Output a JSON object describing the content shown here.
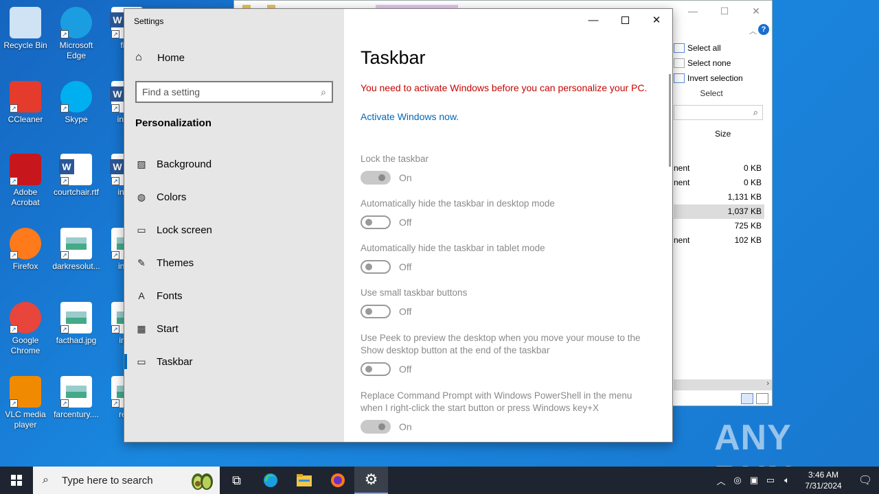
{
  "desktop": {
    "icons_col1": [
      {
        "label": "Recycle Bin",
        "icon": "recycle-bin-icon"
      },
      {
        "label": "CCleaner",
        "icon": "ccleaner-icon"
      },
      {
        "label": "Adobe Acrobat",
        "icon": "acrobat-icon"
      },
      {
        "label": "Firefox",
        "icon": "firefox-icon"
      },
      {
        "label": "Google Chrome",
        "icon": "chrome-icon"
      },
      {
        "label": "VLC media player",
        "icon": "vlc-icon"
      }
    ],
    "icons_col2": [
      {
        "label": "Microsoft Edge",
        "icon": "edge-icon"
      },
      {
        "label": "Skype",
        "icon": "skype-icon"
      },
      {
        "label": "courtchair.rtf",
        "icon": "word-doc-icon"
      },
      {
        "label": "darkresolut...",
        "icon": "image-file-icon"
      },
      {
        "label": "facthad.jpg",
        "icon": "image-file-icon"
      },
      {
        "label": "farcentury....",
        "icon": "image-file-icon"
      }
    ],
    "icons_col3": [
      {
        "label": "fipa",
        "icon": "word-doc-icon"
      },
      {
        "label": "index",
        "icon": "word-doc-icon"
      },
      {
        "label": "indivi",
        "icon": "word-doc-icon"
      },
      {
        "label": "insur",
        "icon": "image-file-icon"
      },
      {
        "label": "inter",
        "icon": "image-file-icon"
      },
      {
        "label": "read",
        "icon": "image-file-icon"
      }
    ],
    "watermark": "ANY RUN"
  },
  "explorer": {
    "select_all": "Select all",
    "select_none": "Select none",
    "invert_selection": "Invert selection",
    "group_label": "Select",
    "size_header": "Size",
    "rows": [
      {
        "type": "nent",
        "size": "0 KB"
      },
      {
        "type": "nent",
        "size": "0 KB"
      },
      {
        "type": "",
        "size": "1,131 KB"
      },
      {
        "type": "",
        "size": "1,037 KB"
      },
      {
        "type": "",
        "size": "725 KB"
      },
      {
        "type": "nent",
        "size": "102 KB"
      }
    ]
  },
  "settings": {
    "window_title": "Settings",
    "home_label": "Home",
    "search_placeholder": "Find a setting",
    "section": "Personalization",
    "nav": [
      {
        "label": "Background",
        "icon": "image-icon"
      },
      {
        "label": "Colors",
        "icon": "palette-icon"
      },
      {
        "label": "Lock screen",
        "icon": "lock-screen-icon"
      },
      {
        "label": "Themes",
        "icon": "brush-icon"
      },
      {
        "label": "Fonts",
        "icon": "font-icon"
      },
      {
        "label": "Start",
        "icon": "start-icon"
      },
      {
        "label": "Taskbar",
        "icon": "taskbar-icon"
      }
    ],
    "page_title": "Taskbar",
    "warning": "You need to activate Windows before you can personalize your PC.",
    "activate_link": "Activate Windows now.",
    "options": [
      {
        "label": "Lock the taskbar",
        "state": "On"
      },
      {
        "label": "Automatically hide the taskbar in desktop mode",
        "state": "Off"
      },
      {
        "label": "Automatically hide the taskbar in tablet mode",
        "state": "Off"
      },
      {
        "label": "Use small taskbar buttons",
        "state": "Off"
      },
      {
        "label": "Use Peek to preview the desktop when you move your mouse to the Show desktop button at the end of the taskbar",
        "state": "Off"
      },
      {
        "label": "Replace Command Prompt with Windows PowerShell in the menu when I right-click the start button or press Windows key+X",
        "state": "On"
      }
    ]
  },
  "taskbar": {
    "search_placeholder": "Type here to search",
    "time": "3:46 AM",
    "date": "7/31/2024"
  }
}
